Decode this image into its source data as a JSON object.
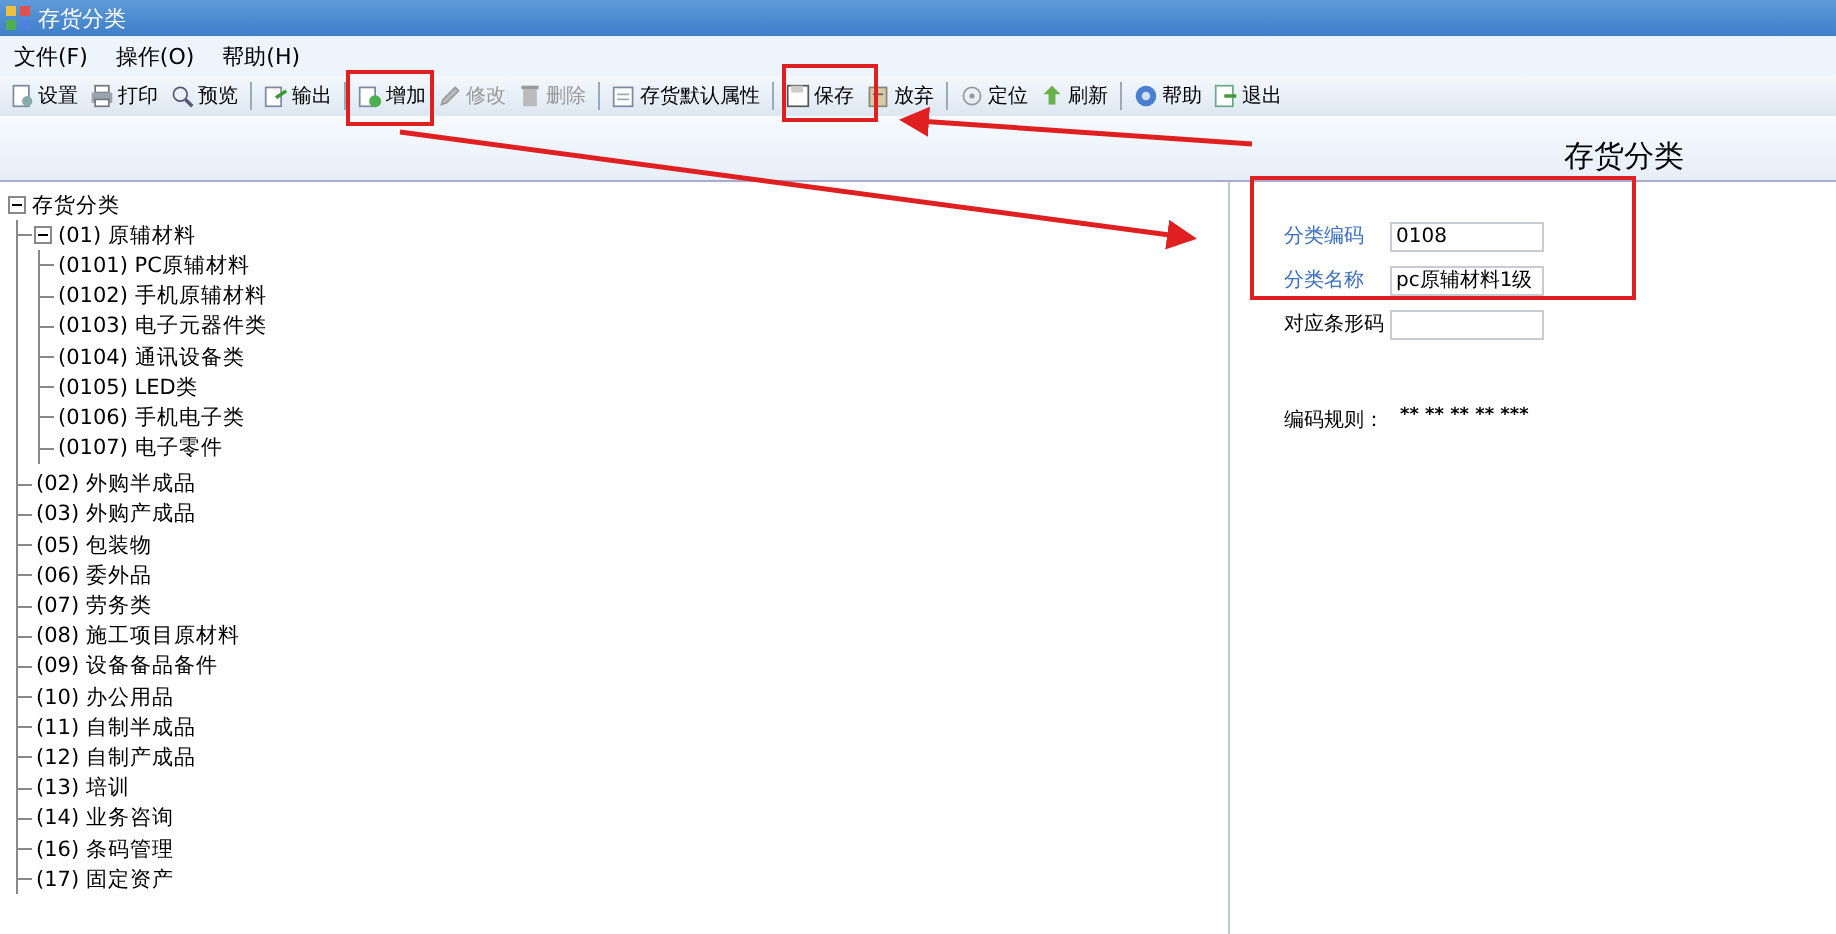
{
  "window": {
    "title": "存货分类"
  },
  "menu": [
    "文件(F)",
    "操作(O)",
    "帮助(H)"
  ],
  "toolbar": [
    {
      "kind": "button",
      "label": "设置",
      "disabled": false
    },
    {
      "kind": "button",
      "label": "打印",
      "disabled": false
    },
    {
      "kind": "button",
      "label": "预览",
      "disabled": false
    },
    {
      "kind": "separator"
    },
    {
      "kind": "button",
      "label": "输出",
      "disabled": false
    },
    {
      "kind": "separator"
    },
    {
      "kind": "button",
      "label": "增加",
      "disabled": false
    },
    {
      "kind": "button",
      "label": "修改",
      "disabled": true
    },
    {
      "kind": "button",
      "label": "删除",
      "disabled": true
    },
    {
      "kind": "separator"
    },
    {
      "kind": "button",
      "label": "存货默认属性",
      "disabled": false
    },
    {
      "kind": "separator"
    },
    {
      "kind": "button",
      "label": "保存",
      "disabled": false
    },
    {
      "kind": "button",
      "label": "放弃",
      "disabled": false
    },
    {
      "kind": "separator"
    },
    {
      "kind": "button",
      "label": "定位",
      "disabled": false
    },
    {
      "kind": "button",
      "label": "刷新",
      "disabled": false
    },
    {
      "kind": "separator"
    },
    {
      "kind": "button",
      "label": "帮助",
      "disabled": false
    },
    {
      "kind": "button",
      "label": "退出",
      "disabled": false
    }
  ],
  "form_title": "存货分类",
  "tree": [
    {
      "label": "存货分类",
      "expanded": true,
      "children": [
        {
          "label": "(01) 原辅材料",
          "expanded": true,
          "children": [
            {
              "label": "(0101) PC原辅材料"
            },
            {
              "label": "(0102) 手机原辅材料"
            },
            {
              "label": "(0103) 电子元器件类"
            },
            {
              "label": "(0104) 通讯设备类"
            },
            {
              "label": "(0105) LED类"
            },
            {
              "label": "(0106) 手机电子类"
            },
            {
              "label": "(0107) 电子零件"
            }
          ]
        },
        {
          "label": "(02) 外购半成品"
        },
        {
          "label": "(03) 外购产成品"
        },
        {
          "label": "(05) 包装物"
        },
        {
          "label": "(06) 委外品"
        },
        {
          "label": "(07) 劳务类"
        },
        {
          "label": "(08) 施工项目原材料"
        },
        {
          "label": "(09) 设备备品备件"
        },
        {
          "label": "(10) 办公用品"
        },
        {
          "label": "(11) 自制半成品"
        },
        {
          "label": "(12) 自制产成品"
        },
        {
          "label": "(13) 培训"
        },
        {
          "label": "(14) 业务咨询"
        },
        {
          "label": "(16) 条码管理"
        },
        {
          "label": "(17) 固定资产"
        }
      ]
    }
  ],
  "form": {
    "fields": [
      {
        "label": "分类编码",
        "required": true,
        "value": "0108"
      },
      {
        "label": "分类名称",
        "required": true,
        "value": "pc原辅材料1级"
      },
      {
        "label": "对应条形码",
        "required": false
      }
    ],
    "coding_rule": {
      "label": "编码规则：",
      "value": "** ** ** ** ***"
    }
  }
}
